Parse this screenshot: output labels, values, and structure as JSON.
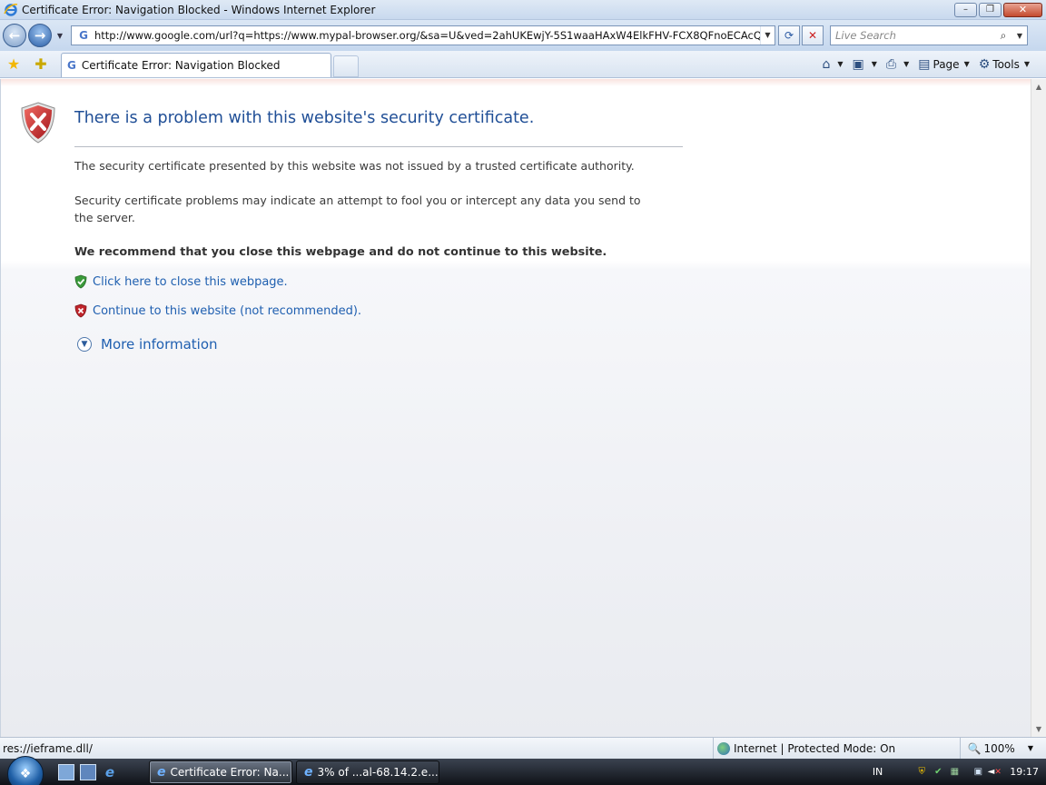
{
  "window": {
    "title": "Certificate Error: Navigation Blocked - Windows Internet Explorer",
    "controls": {
      "minimize": "–",
      "maximize": "❐",
      "close": "✕"
    }
  },
  "nav": {
    "back_glyph": "←",
    "forward_glyph": "→",
    "address_value": "http://www.google.com/url?q=https://www.mypal-browser.org/&sa=U&ved=2ahUKEwjY-5S1waaHAxW4ElkFHV-FCX8QFnoECAcQAg&usg=AOvVaw",
    "address_icon": "G",
    "search_placeholder": "Live Search"
  },
  "tabs": {
    "active_label": "Certificate Error: Navigation Blocked",
    "tab_icon": "G"
  },
  "command_bar": {
    "page_label": "Page",
    "tools_label": "Tools"
  },
  "content": {
    "heading": "There is a problem with this website's security certificate.",
    "paragraph_1": "The security certificate presented by this website was not issued by a trusted certificate authority.",
    "paragraph_2": "Security certificate problems may indicate an attempt to fool you or intercept any data you send to the server.",
    "recommendation": "We recommend that you close this webpage and do not continue to this website.",
    "close_link": "Click here to close this webpage.",
    "continue_link": "Continue to this website (not recommended).",
    "more_info_link": "More information"
  },
  "status_bar": {
    "status_text": "res://ieframe.dll/",
    "zone_text": "Internet | Protected Mode: On",
    "zoom_text": "100%"
  },
  "taskbar": {
    "ie_task_label": "Certificate Error: Na...",
    "download_task_label": "3% of ...al-68.14.2.e...",
    "language": "IN",
    "clock": "19:17"
  },
  "colors": {
    "heading": "#1f4e96",
    "link": "#1f5fb0",
    "error_red": "#c0252b",
    "safe_green": "#3a9a3a"
  },
  "icons": [
    "ie-logo-icon",
    "back-arrow-icon",
    "forward-arrow-icon",
    "google-icon",
    "refresh-icon",
    "stop-icon",
    "search-icon",
    "favorites-star-icon",
    "add-favorites-icon",
    "home-icon",
    "feeds-icon",
    "print-icon",
    "page-icon",
    "gear-icon",
    "shield-error-icon",
    "shield-check-icon",
    "chevron-down-icon",
    "globe-icon",
    "zoom-icon",
    "windows-orb-icon"
  ]
}
